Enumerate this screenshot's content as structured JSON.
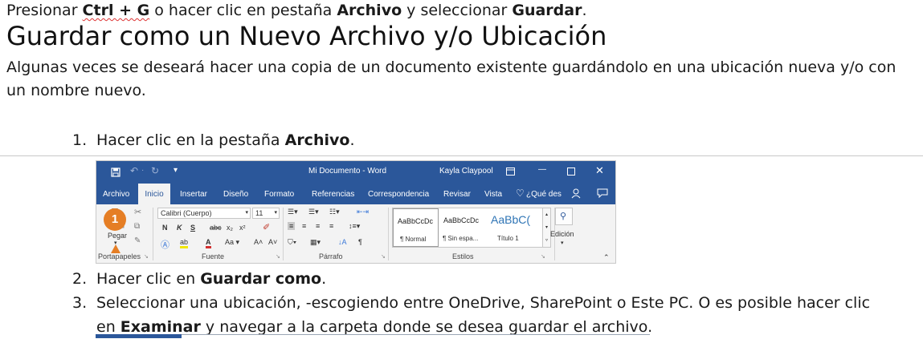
{
  "intro": {
    "pre": "Presionar ",
    "key": "Ctrl + G",
    "mid": " o hacer clic en pestaña ",
    "tab": "Archivo",
    "mid2": " y seleccionar ",
    "cmd": "Guardar",
    "end": "."
  },
  "heading": "Guardar como un Nuevo Archivo y/o Ubicación",
  "paragraph": "Algunas veces se deseará hacer una copia de un documento existente guardándolo en una ubicación nueva y/o con un nombre nuevo.",
  "steps": [
    {
      "num": "1.",
      "pre": "Hacer clic en la pestaña ",
      "bold": "Archivo",
      "post": "."
    },
    {
      "num": "2.",
      "pre": "Hacer clic en ",
      "bold": "Guardar como",
      "post": "."
    },
    {
      "num": "3.",
      "pre": "Seleccionar una ubicación, -escogiendo entre OneDrive, SharePoint o Este PC. O es posible hacer clic en ",
      "bold": "Examinar",
      "post": " y navegar a la carpeta donde se desea guardar el archivo."
    }
  ],
  "ribbon": {
    "title": "Mi Documento  -  Word",
    "user": "Kayla Claypool",
    "tabs": [
      "Archivo",
      "Inicio",
      "Insertar",
      "Diseño",
      "Formato",
      "Referencias",
      "Correspondencia",
      "Revisar",
      "Vista"
    ],
    "tell_me": "¿Qué des",
    "font_name": "Calibri (Cuerpo)",
    "font_size": "11",
    "paste_label": "Pegar",
    "styles": [
      {
        "preview": "AaBbCcDc",
        "name": "¶ Normal"
      },
      {
        "preview": "AaBbCcDc",
        "name": "¶ Sin espa..."
      },
      {
        "preview": "AaBbC(",
        "name": "Título 1"
      }
    ],
    "editing_label": "Edición",
    "groups": [
      "Portapapeles",
      "Fuente",
      "Párrafo",
      "Estilos"
    ],
    "badge": "1",
    "font_buttons": [
      "N",
      "K",
      "S",
      "abc",
      "x₂",
      "x²"
    ],
    "accent": "#2b579a",
    "badge_color": "#e57e25"
  }
}
